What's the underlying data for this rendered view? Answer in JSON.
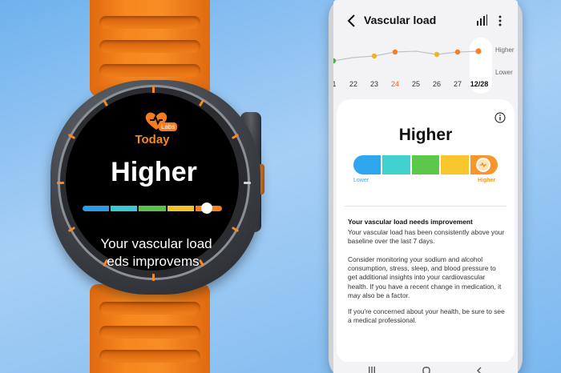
{
  "watch": {
    "brand_badge": "Labs",
    "title": "Today",
    "level": "Higher",
    "message_line1": "Your vascular load",
    "message_line2": "eds improvems",
    "bar_colors": [
      "#2f9ae8",
      "#38c9d2",
      "#58c24a",
      "#f3c12c",
      "#f47f24"
    ],
    "indicator_position": 0.9
  },
  "phone": {
    "title": "Vascular load",
    "trend": {
      "days": [
        "1",
        "22",
        "23",
        "24",
        "25",
        "26",
        "27",
        "12/28"
      ],
      "highlighted_day": "24",
      "selected_day": "12/28",
      "level_high_label": "Higher",
      "level_low_label": "Lower",
      "point_colors": [
        "#4caf50",
        "#f3b12c",
        "#f3b12c",
        "#f47f24",
        "#f3b12c",
        "#f3b12c",
        "#f47f24",
        "#f47f24"
      ]
    },
    "card": {
      "level": "Higher",
      "scale_lower_label": "Lower",
      "scale_higher_label": "Higher",
      "scale_colors": [
        "#2fa7ee",
        "#3fd0cf",
        "#5cc84a",
        "#f7c52c",
        "#f7962a"
      ],
      "indicator_position": 0.95,
      "heading": "Your vascular load needs improvement",
      "paragraph1": "Your vascular load has been consistently above your baseline over the last 7 days.",
      "paragraph2": "Consider monitoring your sodium and alcohol consumption, stress, sleep, and blood pressure to get additional insights into your cardiovascular health. If you have a recent change in medication, it may also be a factor.",
      "paragraph3": "If you're concerned about your health, be sure to see a medical professional."
    },
    "icons": {
      "back": "back-arrow-icon",
      "chart": "bar-chart-icon",
      "more": "more-vertical-icon",
      "info": "info-icon"
    }
  }
}
